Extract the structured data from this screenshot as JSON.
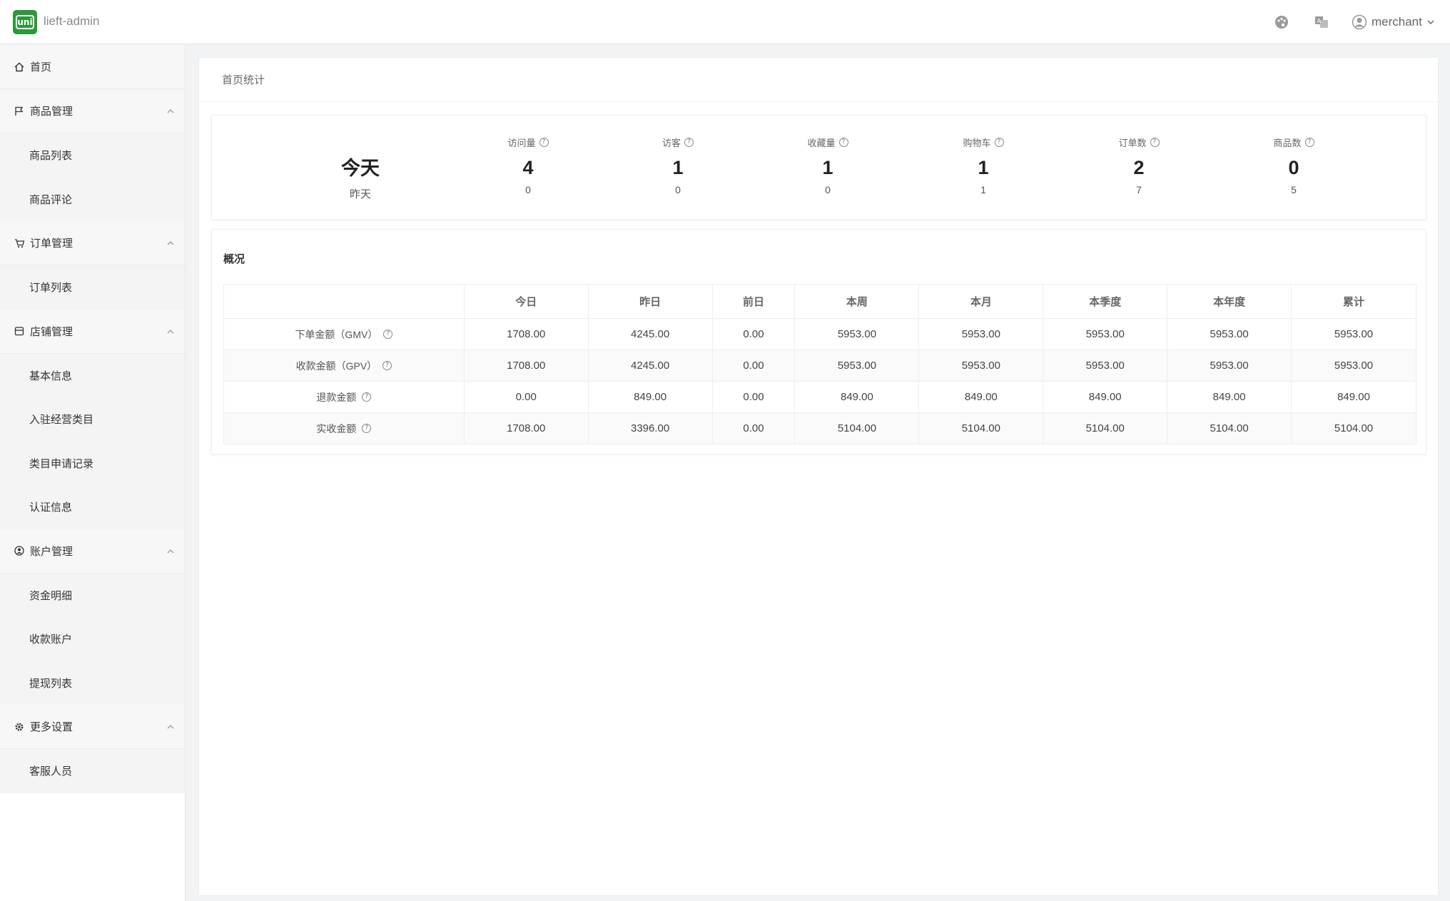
{
  "header": {
    "logo_text": "uni",
    "app_title": "lieft-admin",
    "user_name": "merchant"
  },
  "sidebar": {
    "home": "首页",
    "groups": [
      {
        "label": "商品管理",
        "items": [
          "商品列表",
          "商品评论"
        ]
      },
      {
        "label": "订单管理",
        "items": [
          "订单列表"
        ]
      },
      {
        "label": "店铺管理",
        "items": [
          "基本信息",
          "入驻经营类目",
          "类目申请记录",
          "认证信息"
        ]
      },
      {
        "label": "账户管理",
        "items": [
          "资金明细",
          "收款账户",
          "提现列表"
        ]
      },
      {
        "label": "更多设置",
        "items": [
          "客服人员"
        ]
      }
    ]
  },
  "breadcrumb": "首页统计",
  "stats": {
    "today_label": "今天",
    "yesterday_label": "昨天",
    "cols": [
      {
        "title": "访问量",
        "today": "4",
        "yesterday": "0"
      },
      {
        "title": "访客",
        "today": "1",
        "yesterday": "0"
      },
      {
        "title": "收藏量",
        "today": "1",
        "yesterday": "0"
      },
      {
        "title": "购物车",
        "today": "1",
        "yesterday": "1"
      },
      {
        "title": "订单数",
        "today": "2",
        "yesterday": "7"
      },
      {
        "title": "商品数",
        "today": "0",
        "yesterday": "5"
      }
    ]
  },
  "overview": {
    "title": "概况",
    "headers": [
      "今日",
      "昨日",
      "前日",
      "本周",
      "本月",
      "本季度",
      "本年度",
      "累计"
    ],
    "rows": [
      {
        "label": "下单金额（GMV）",
        "values": [
          "1708.00",
          "4245.00",
          "0.00",
          "5953.00",
          "5953.00",
          "5953.00",
          "5953.00",
          "5953.00"
        ]
      },
      {
        "label": "收款金额（GPV）",
        "values": [
          "1708.00",
          "4245.00",
          "0.00",
          "5953.00",
          "5953.00",
          "5953.00",
          "5953.00",
          "5953.00"
        ]
      },
      {
        "label": "退款金额",
        "values": [
          "0.00",
          "849.00",
          "0.00",
          "849.00",
          "849.00",
          "849.00",
          "849.00",
          "849.00"
        ]
      },
      {
        "label": "实收金额",
        "values": [
          "1708.00",
          "3396.00",
          "0.00",
          "5104.00",
          "5104.00",
          "5104.00",
          "5104.00",
          "5104.00"
        ]
      }
    ]
  },
  "colors": {
    "brand": "#2b9939"
  }
}
